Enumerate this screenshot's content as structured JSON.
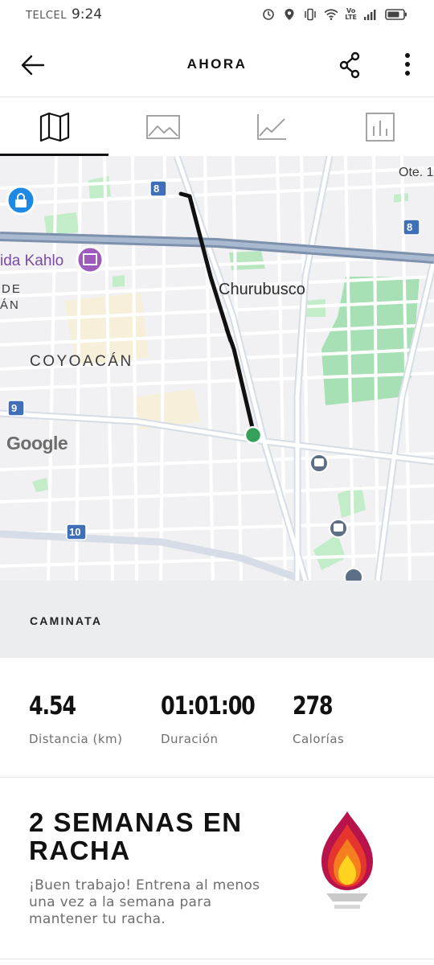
{
  "status_bar": {
    "carrier": "TELCEL",
    "time": "9:24",
    "volte_line1": "Vo",
    "volte_line2": "LTE"
  },
  "header": {
    "title": "AHORA",
    "back_icon": "arrow-left-icon",
    "share_icon": "share-icon",
    "more_icon": "more-vertical-icon"
  },
  "tabs": [
    {
      "icon": "map-icon",
      "active": true
    },
    {
      "icon": "image-icon",
      "active": false
    },
    {
      "icon": "line-chart-icon",
      "active": false
    },
    {
      "icon": "bar-chart-icon",
      "active": false
    }
  ],
  "map": {
    "labels": {
      "churubusco": "Churubusco",
      "coyoacan": "COYOACÁN",
      "frida": "ida Kahlo",
      "de": "DE",
      "an": "ÁN",
      "ote": "Ote. 1",
      "google": "Google"
    },
    "road_shields": [
      "8",
      "8",
      "9",
      "10"
    ],
    "colors": {
      "background": "#f1f1f3",
      "park": "#a8e0b5",
      "route": "#111111",
      "endpoint": "#34a05a",
      "highway": "#8e9fb5",
      "shield": "#3e6fb7"
    }
  },
  "activity": {
    "type": "CAMINATA"
  },
  "stats": {
    "distance_value": "4.54",
    "distance_label": "Distancia (km)",
    "duration_value": "01:01:00",
    "duration_label": "Duración",
    "calories_value": "278",
    "calories_label": "Calorías"
  },
  "streak": {
    "title": "2 SEMANAS EN RACHA",
    "description": "¡Buen trabajo! Entrena al menos una vez a la semana para mantener tu racha.",
    "icon": "flame-torch-icon"
  }
}
